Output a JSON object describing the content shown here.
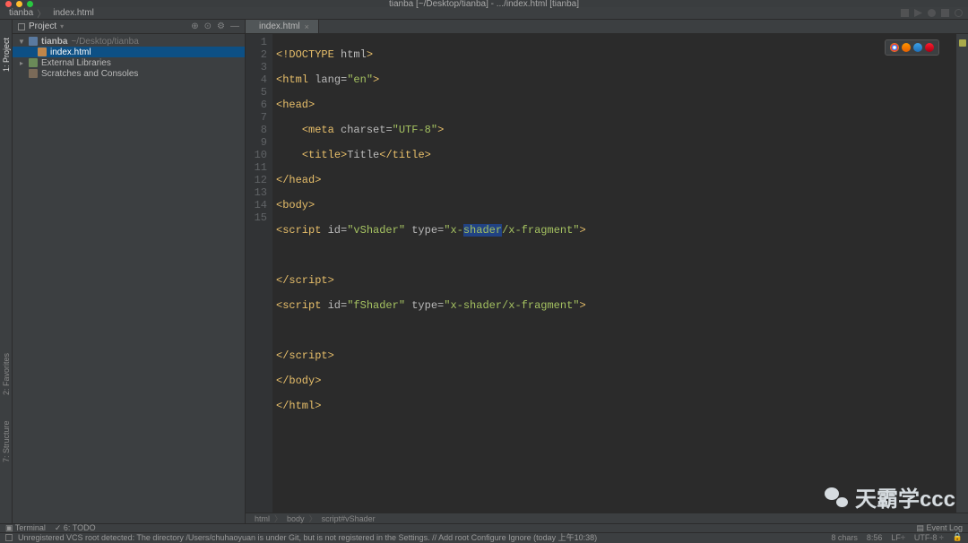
{
  "window": {
    "title": "tianba [~/Desktop/tianba] - .../index.html [tianba]"
  },
  "navbar": {
    "project_folder": "tianba",
    "open_file": "index.html"
  },
  "project_panel": {
    "title": "Project",
    "root_name": "tianba",
    "root_path": "~/Desktop/tianba",
    "file_selected": "index.html",
    "external_libs": "External Libraries",
    "scratches": "Scratches and Consoles"
  },
  "editor": {
    "tab_label": "index.html",
    "lines": [
      "1",
      "2",
      "3",
      "4",
      "5",
      "6",
      "7",
      "8",
      "9",
      "10",
      "11",
      "12",
      "13",
      "14",
      "15"
    ]
  },
  "code": {
    "l1_a": "<!DOCTYPE ",
    "l1_b": "html",
    "l1_c": ">",
    "l2_a": "<html ",
    "l2_attr": "lang",
    "l2_eq": "=",
    "l2_val": "\"en\"",
    "l2_c": ">",
    "l3": "<head>",
    "l4_a": "<meta ",
    "l4_attr": "charset",
    "l4_eq": "=",
    "l4_val": "\"UTF-8\"",
    "l4_c": ">",
    "l5_a": "<title>",
    "l5_t": "Title",
    "l5_b": "</title>",
    "l6": "</head>",
    "l7": "<body>",
    "l8_a": "<script ",
    "l8_attr1": "id",
    "l8_eq1": "=",
    "l8_val1": "\"vShader\"",
    "l8_sp": " ",
    "l8_attr2": "type",
    "l8_eq2": "=",
    "l8_val2a": "\"x-",
    "l8_val2b": "shader",
    "l8_val2c": "/x-fragment\"",
    "l8_c": ">",
    "l10": "</script>",
    "l11_a": "<script ",
    "l11_attr1": "id",
    "l11_eq1": "=",
    "l11_val1": "\"fShader\"",
    "l11_sp": " ",
    "l11_attr2": "type",
    "l11_eq2": "=",
    "l11_val2": "\"x-shader/x-fragment\"",
    "l11_c": ">",
    "l13": "</script>",
    "l14": "</body>",
    "l15": "</html>"
  },
  "crumbs": {
    "c1": "html",
    "c2": "body",
    "c3": "script#vShader"
  },
  "tool_bar": {
    "terminal": "Terminal",
    "todo": "6: TODO",
    "event_log": "Event Log"
  },
  "status": {
    "msg": "Unregistered VCS root detected: The directory /Users/chuhaoyuan is under Git, but is not registered in the Settings. // Add root  Configure  Ignore (today 上午10:38)",
    "chars": "8 chars",
    "pos": "8:56",
    "lf": "LF÷",
    "enc": "UTF-8 ÷",
    "lock": "🔒"
  },
  "left_tools": {
    "project": "1: Project",
    "favorites": "2: Favorites",
    "structure": "7: Structure"
  },
  "watermark": "天霸学ccc"
}
